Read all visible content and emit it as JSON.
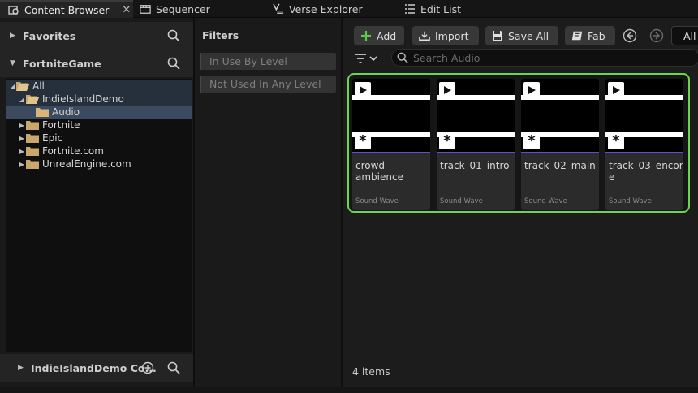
{
  "tabs": [
    {
      "label": "Content Browser",
      "icon": "content-browser-icon",
      "active": true
    },
    {
      "label": "Sequencer",
      "icon": "clapperboard-icon"
    },
    {
      "label": "Verse Explorer",
      "icon": "verse-icon"
    },
    {
      "label": "Edit List",
      "icon": "list-icon"
    }
  ],
  "sidebar": {
    "favorites_label": "Favorites",
    "project_label": "FortniteGame",
    "tree": [
      {
        "label": "All",
        "depth": 0,
        "expanded": true
      },
      {
        "label": "IndieIslandDemo",
        "depth": 1,
        "expanded": true
      },
      {
        "label": "Audio",
        "depth": 2,
        "selected": true
      },
      {
        "label": "Fortnite",
        "depth": 1
      },
      {
        "label": "Epic",
        "depth": 1
      },
      {
        "label": "Fortnite.com",
        "depth": 1
      },
      {
        "label": "UnrealEngine.com",
        "depth": 1
      }
    ],
    "collections_label": "IndieIslandDemo Co..."
  },
  "filters": {
    "title": "Filters",
    "items": [
      "In Use By Level",
      "Not Used In Any Level"
    ]
  },
  "toolbar": {
    "add_label": "Add",
    "import_label": "Import",
    "save_all_label": "Save All",
    "fab_label": "Fab",
    "all_label": "All",
    "search_placeholder": "Search Audio"
  },
  "assets": [
    {
      "name": "crowd_ambience",
      "display_name": "crowd_\nambience",
      "type": "Sound Wave"
    },
    {
      "name": "track_01_intro",
      "display_name": "track_01_intro",
      "type": "Sound Wave"
    },
    {
      "name": "track_02_main",
      "display_name": "track_02_main",
      "type": "Sound Wave"
    },
    {
      "name": "track_03_encore",
      "display_name": "track_03_encore",
      "type": "Sound Wave"
    }
  ],
  "status": {
    "item_count": "4 items"
  },
  "colors": {
    "selection_border": "#6ad64a",
    "asset_type_line": "#5a4fd0",
    "add_icon": "#5cc84a"
  }
}
